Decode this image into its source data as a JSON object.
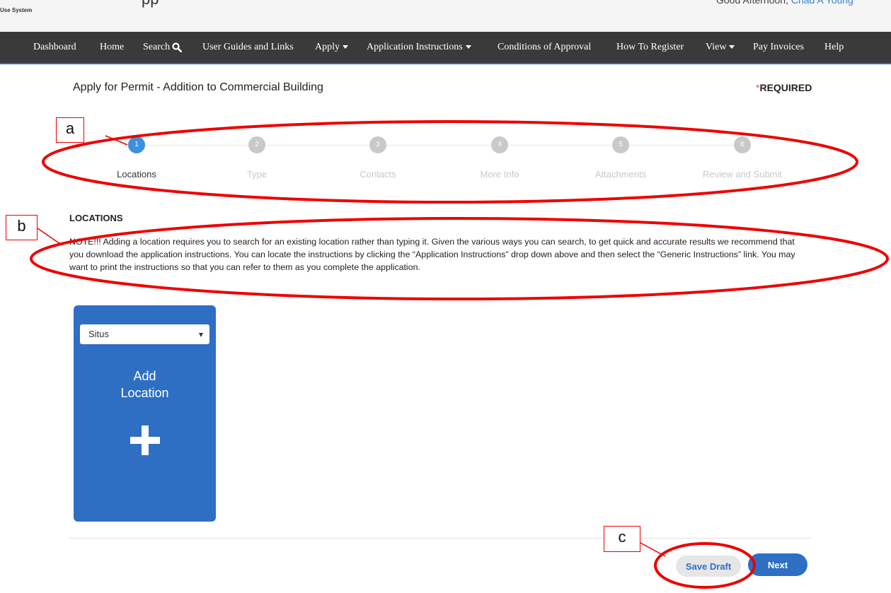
{
  "header": {
    "system_label": "Use System",
    "app_title_fragment": "pp",
    "greeting": "Good Afternoon,",
    "user_name": "Chad A Young"
  },
  "nav": {
    "items": [
      {
        "label": "Dashboard"
      },
      {
        "label": "Home"
      },
      {
        "label": "Search",
        "icon": "search-icon"
      },
      {
        "label": "User Guides and Links"
      },
      {
        "label": "Apply",
        "dropdown": true
      },
      {
        "label": "Application Instructions",
        "dropdown": true
      },
      {
        "label": "Conditions of Approval"
      },
      {
        "label": "How To Register"
      },
      {
        "label": "View",
        "dropdown": true
      },
      {
        "label": "Pay Invoices"
      },
      {
        "label": "Help"
      }
    ]
  },
  "page": {
    "title": "Apply for Permit - Addition to Commercial Building",
    "required_asterisk": "*",
    "required_text": "REQUIRED"
  },
  "steps": [
    {
      "num": "1",
      "label": "Locations",
      "active": true
    },
    {
      "num": "2",
      "label": "Type",
      "active": false
    },
    {
      "num": "3",
      "label": "Contacts",
      "active": false
    },
    {
      "num": "4",
      "label": "More Info",
      "active": false
    },
    {
      "num": "5",
      "label": "Attachments",
      "active": false
    },
    {
      "num": "6",
      "label": "Review and Submit",
      "active": false
    }
  ],
  "locations": {
    "section_title": "LOCATIONS",
    "note": "NOTE!!! Adding a location requires you to search for an existing location rather than typing it. Given the various ways you can search, to get quick and accurate results we recommend that you download the application instructions. You can locate the instructions by clicking the “Application Instructions” drop down above and then select the “Generic Instructions” link. You may want to print the instructions so that you can refer to them as you complete the application.",
    "card": {
      "select_value": "Situs",
      "title_line1": "Add",
      "title_line2": "Location",
      "icon": "plus-icon"
    }
  },
  "footer": {
    "save_draft_label": "Save Draft",
    "next_label": "Next"
  },
  "annotations": {
    "a": "a",
    "b": "b",
    "c": "c",
    "color": "#e00000"
  },
  "colors": {
    "navbar_bg": "#3a3a3a",
    "accent_blue": "#2e6fc3",
    "active_step": "#3d8fe0",
    "required_asterisk": "#d9534f"
  }
}
